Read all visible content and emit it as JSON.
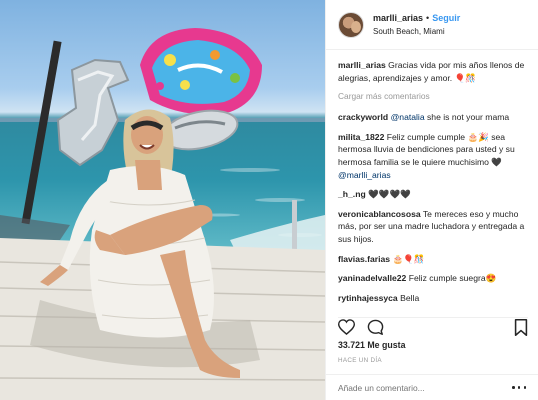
{
  "post": {
    "username": "marlli_arias",
    "separator": "•",
    "follow_label": "Seguir",
    "location": "South Beach, Miami"
  },
  "caption": {
    "username": "marlli_arias",
    "text": "Gracias vida por mis años llenos de alegrias, aprendizajes y amor. 🎈🎊"
  },
  "load_more_label": "Cargar más comentarios",
  "comments": [
    {
      "username": "crackyworld",
      "mention": "@natalia",
      "text": " she is not your mama"
    },
    {
      "username": "milita_1822",
      "text": "Feliz cumple cumple 🎂🎉 sea hermosa lluvia de bendiciones para usted y su hermosa familia se le quiere muchisimo 🖤 ",
      "mention": "@marlli_arias"
    },
    {
      "username": "_h_.ng",
      "text": "🖤🖤🖤🖤"
    },
    {
      "username": "veronicablancososa",
      "text": "Te mereces eso y mucho más, por ser una madre luchadora y entregada a sus hijos."
    },
    {
      "username": "flavias.farias",
      "text": "🎂🎈🎊"
    },
    {
      "username": "yaninadelvalle22",
      "text": "Feliz cumple suegra😍"
    },
    {
      "username": "rytinhajessyca",
      "text": "Bella"
    }
  ],
  "likes": "33.721 Me gusta",
  "time_ago": "HACE UN DÍA",
  "add_comment_placeholder": "Añade un comentario...",
  "icons": {
    "like": "heart-icon",
    "comment": "comment-bubble-icon",
    "save": "bookmark-icon",
    "options": "more-options-icon"
  },
  "colors": {
    "follow": "#3897f0",
    "mention": "#003569",
    "muted": "#999999"
  }
}
